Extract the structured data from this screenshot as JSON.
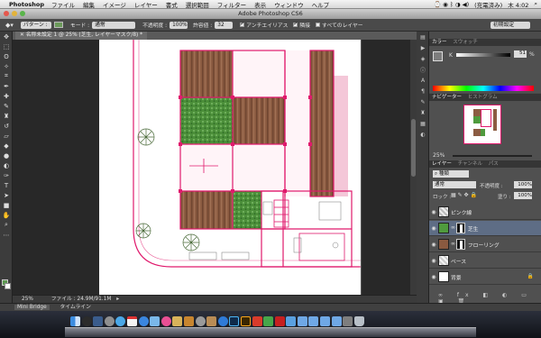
{
  "menubar": {
    "app": "Photoshop",
    "items": [
      "ファイル",
      "編集",
      "イメージ",
      "レイヤー",
      "書式",
      "選択範囲",
      "フィルター",
      "表示",
      "ウィンドウ",
      "ヘルプ"
    ],
    "battery": "(充電済み)",
    "clock": "木 4:02"
  },
  "window": {
    "title": "Adobe Photoshop CS6"
  },
  "options": {
    "pattern_label": "パターン :",
    "mode_label": "モード :",
    "mode_value": "通常",
    "opacity_label": "不透明度 :",
    "opacity_value": "100%",
    "tolerance_label": "許容値 :",
    "tolerance_value": "32",
    "antialias_label": "アンチエイリアス",
    "contiguous_label": "隣接",
    "all_layers_label": "すべてのレイヤー",
    "workspace": "初期設定"
  },
  "document": {
    "tab_title": "名称未設定 1 @ 25% (芝生, レイヤーマスク/8) *",
    "zoom": "25%",
    "file_info": "ファイル : 24.9M/91.1M"
  },
  "bottom_tabs": [
    "Mini Bridge",
    "タイムライン"
  ],
  "panels": {
    "color_tab": "カラー",
    "swatches_tab": "スウォッチ",
    "k_label": "K",
    "k_value": "51",
    "percent": "%",
    "navigator_tab": "ナビゲーター",
    "histogram_tab": "ヒストグラム",
    "nav_zoom": "25%",
    "layers_tab": "レイヤー",
    "channels_tab": "チャンネル",
    "paths_tab": "パス",
    "kind_label": "種類",
    "blend_mode": "通常",
    "opacity_label": "不透明度 :",
    "opacity_value": "100%",
    "lock_label": "ロック :",
    "fill_label": "塗り :",
    "fill_value": "100%"
  },
  "layers": [
    {
      "name": "ピンク線",
      "selected": false
    },
    {
      "name": "芝生",
      "selected": true
    },
    {
      "name": "フローリング",
      "selected": false
    },
    {
      "name": "ベース",
      "selected": false
    },
    {
      "name": "背景",
      "selected": false
    }
  ],
  "colors": {
    "accent_magenta": "#e0196c",
    "grass": "#4f9a3d",
    "wood": "#8a5a40",
    "selection_blue": "#5e6d85"
  }
}
